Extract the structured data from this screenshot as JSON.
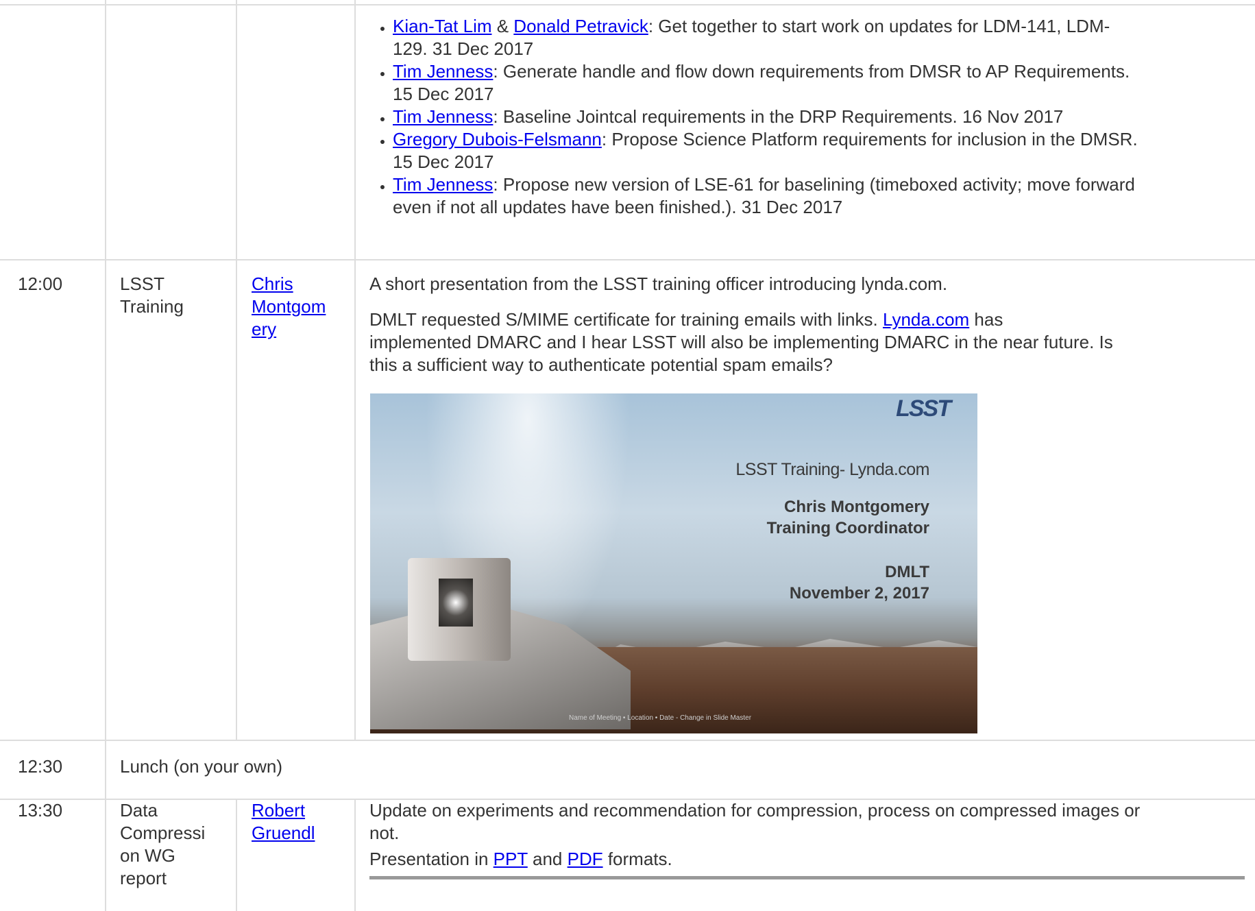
{
  "action_items": [
    {
      "people": [
        {
          "name": "Kian-Tat Lim"
        },
        {
          "name": "Donald Petravick"
        }
      ],
      "separator": " & ",
      "line1": ": Get together to start work on updates for LDM-141, LDM-",
      "line2": "129. 31 Dec 2017"
    },
    {
      "person": "Tim Jenness",
      "line1": ": Generate handle and flow down requirements from DMSR to AP Requirements.",
      "line2": "15 Dec 2017"
    },
    {
      "person": "Tim Jenness",
      "line1": ": Baseline Jointcal requirements in the DRP Requirements. 16 Nov 2017"
    },
    {
      "person": "Gregory Dubois-Felsmann",
      "line1": ": Propose Science Platform requirements for inclusion in the DMSR.",
      "line2": "15 Dec 2017"
    },
    {
      "person": "Tim Jenness",
      "line1": ": Propose new version of LSE-61 for baselining (timeboxed activity; move forward",
      "line2": "even if not all updates have been finished.). 31 Dec 2017"
    }
  ],
  "row_training": {
    "time": "12:00",
    "item_line1": "LSST",
    "item_line2": "Training",
    "who_line1": "Chris",
    "who_line2": "Montgom",
    "who_line3": "ery",
    "intro": "A short presentation from the LSST training officer introducing lynda.com.",
    "dmlt_line1_pre": "DMLT requested S/MIME certificate for training emails with links. ",
    "dmlt_link": "Lynda.com",
    "dmlt_line1_post": " has",
    "dmlt_line2": "implemented DMARC and I hear LSST will also be implementing DMARC in the near future. Is",
    "dmlt_line3": "this a sufficient way to authenticate potential spam emails?",
    "slide": {
      "logo": "LSST",
      "title": "LSST Training- Lynda.com",
      "presenter_name": "Chris Montgomery",
      "presenter_role": "Training Coordinator",
      "event": "DMLT",
      "date": "November 2, 2017",
      "footer": "Name of Meeting • Location • Date - Change in Slide Master"
    }
  },
  "row_lunch": {
    "time": "12:30",
    "label": "Lunch (on your own)"
  },
  "row_compression": {
    "time": "13:30",
    "item_lines": [
      "Data",
      "Compressi",
      "on WG",
      "report"
    ],
    "who_line1": "Robert",
    "who_line2": "Gruendl",
    "desc_line1": "Update on experiments and recommendation for compression, process on compressed images or",
    "desc_line2": "not.",
    "pres_pre": "Presentation in ",
    "ppt": "PPT",
    "pres_and": " and ",
    "pdf": "PDF",
    "pres_post": " formats."
  }
}
